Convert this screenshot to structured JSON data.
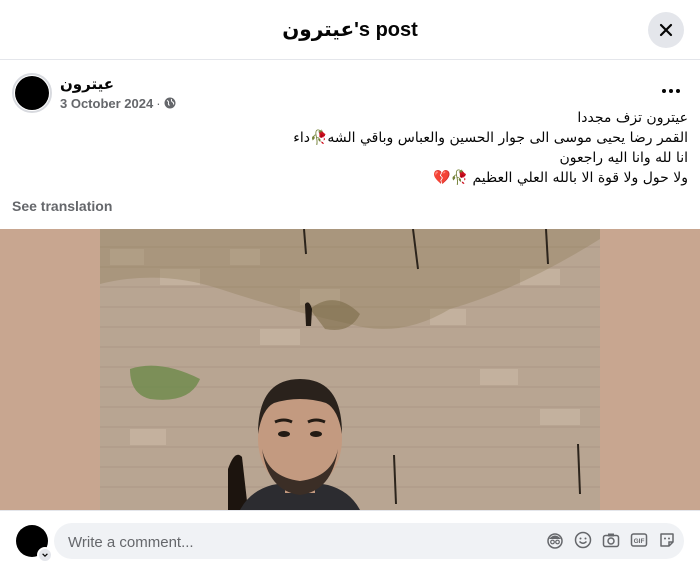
{
  "header": {
    "title": "عيترون's post"
  },
  "post": {
    "author": "عيترون",
    "date": "3 October 2024",
    "meta_separator": "·",
    "text_lines": [
      "عيترون تزف مجددا",
      "القمر رضا يحيى موسى الى جوار الحسين والعباس وباقي الشه🥀داء",
      "انا لله وانا اليه راجعون",
      "ولا حول ولا قوة الا بالله العلي العظيم 🥀💔"
    ],
    "see_translation": "See translation"
  },
  "comment": {
    "placeholder": "Write a comment..."
  },
  "colors": {
    "photo_background": "#c8a690",
    "control_gray": "#e4e6eb",
    "secondary_text": "#65676b"
  },
  "icons": [
    "close-icon",
    "more-icon",
    "globe-icon",
    "avatar-sticker-icon",
    "emoji-icon",
    "camera-icon",
    "gif-icon",
    "sticker-icon",
    "chevron-down-icon"
  ]
}
